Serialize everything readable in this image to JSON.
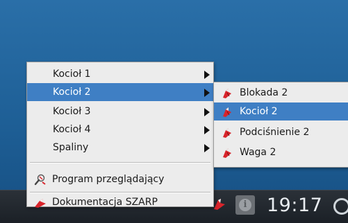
{
  "menu": {
    "items": [
      {
        "label": "Kocioł 1",
        "has_submenu": true
      },
      {
        "label": "Kocioł 2",
        "has_submenu": true,
        "selected": true
      },
      {
        "label": "Kocioł 3",
        "has_submenu": true
      },
      {
        "label": "Kocioł 4",
        "has_submenu": true
      },
      {
        "label": "Spaliny",
        "has_submenu": true
      }
    ],
    "viewer": {
      "label": "Program przeglądający",
      "icon": "magnifier-icon"
    },
    "docs": {
      "label": "Dokumentacja SZARP",
      "icon": "szarp-docs-icon"
    }
  },
  "submenu": {
    "items": [
      {
        "label": "Blokada 2",
        "icon": "szarp-icon"
      },
      {
        "label": "Kocioł 2",
        "icon": "szarp-icon",
        "selected": true
      },
      {
        "label": "Podciśnienie 2",
        "icon": "szarp-icon"
      },
      {
        "label": "Waga 2",
        "icon": "szarp-icon"
      }
    ]
  },
  "taskbar": {
    "clock": "19:17",
    "info_glyph": "i"
  },
  "colors": {
    "selection": "#3f7fc4",
    "menu_bg": "#ececec",
    "desktop": "#2a6fa8"
  }
}
